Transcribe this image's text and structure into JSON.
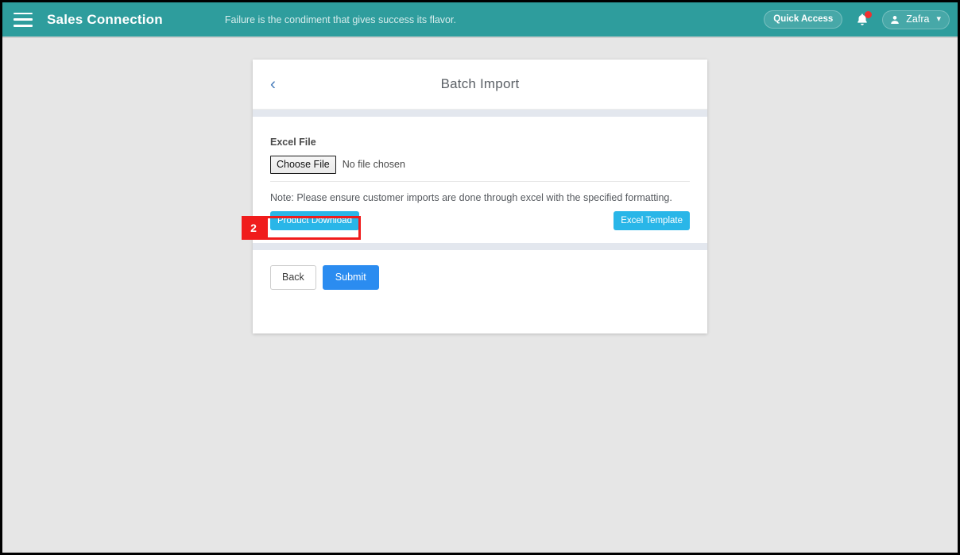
{
  "navbar": {
    "menu_icon": "hamburger-menu-icon",
    "brand": "Sales Connection",
    "tagline": "Failure is the condiment that gives success its flavor.",
    "quick_access_label": "Quick Access",
    "bell_icon": "notification-bell-icon",
    "bell_has_badge": true,
    "user_icon": "user-avatar-icon",
    "user_name": "Zafra",
    "caret_icon": "chevron-down-icon",
    "background_color": "#2e9d9d"
  },
  "card": {
    "back_icon": "chevron-left-icon",
    "title": "Batch Import",
    "excel_file_label": "Excel File",
    "choose_file_button": "Choose File",
    "file_status": "No file chosen",
    "note": "Note: Please ensure customer imports are done through excel with the specified formatting.",
    "product_download_label": "Product Download",
    "excel_template_label": "Excel Template",
    "back_button": "Back",
    "submit_button": "Submit"
  },
  "annotation": {
    "number": "2",
    "color": "#f01c1c",
    "target": "product-download-button"
  },
  "colors": {
    "header_teal": "#2e9d9d",
    "page_background": "#e6e6e6",
    "cyan_button": "#29b6e8",
    "submit_blue": "#2b8cf0",
    "band_gray": "#e3e7ee",
    "annotation_red": "#f01c1c"
  }
}
